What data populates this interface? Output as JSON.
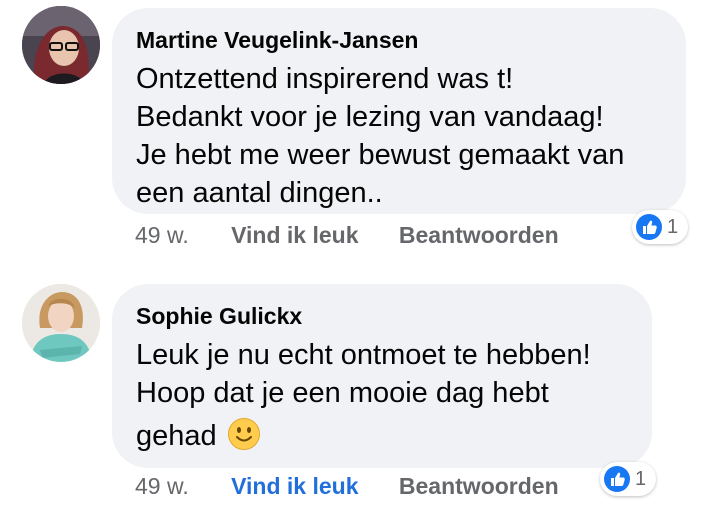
{
  "comments": [
    {
      "author": "Martine Veugelink-Jansen",
      "lines": [
        "Ontzettend inspirerend was t!",
        "Bedankt voor je lezing van vandaag!",
        "Je hebt me weer bewust gemaakt van",
        "een aantal dingen.."
      ],
      "time": "49 w.",
      "like_label": "Vind ik leuk",
      "reply_label": "Beantwoorden",
      "reaction_count": "1",
      "liked": false
    },
    {
      "author": "Sophie Gulickx",
      "lines": [
        "Leuk je nu echt ontmoet te hebben!",
        "Hoop dat je een mooie dag hebt",
        "gehad"
      ],
      "emoji": "slightly-smiling-face-icon",
      "time": "49 w.",
      "like_label": "Vind ik leuk",
      "reply_label": "Beantwoorden",
      "reaction_count": "1",
      "liked": true
    }
  ],
  "colors": {
    "bubble": "#f0f2f5",
    "meta_text": "#65676b",
    "like_active": "#216fdb",
    "like_icon": "#1877f2"
  }
}
